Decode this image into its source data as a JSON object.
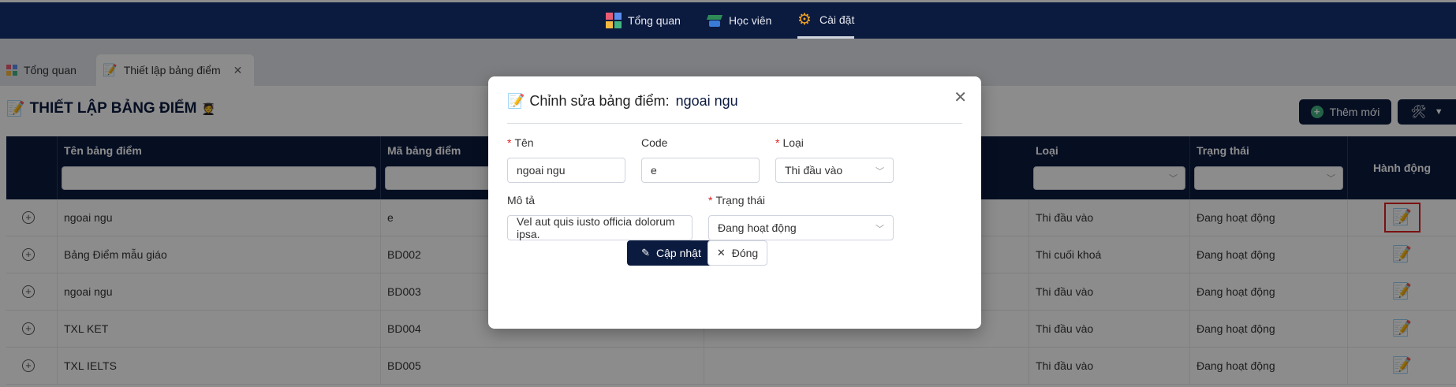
{
  "topnav": {
    "items": [
      {
        "label": "Tổng quan",
        "icon": "dashboard-icon"
      },
      {
        "label": "Học viên",
        "icon": "student-icon"
      },
      {
        "label": "Cài đặt",
        "icon": "gear-icon",
        "active": true
      }
    ]
  },
  "tabs": [
    {
      "label": "Tổng quan",
      "icon": "dashboard-icon"
    },
    {
      "label": "Thiết lập bảng điểm",
      "icon": "memo-icon",
      "active": true
    }
  ],
  "page": {
    "title": "THIẾT LẬP BẢNG ĐIỂM",
    "add_button": "Thêm mới"
  },
  "table": {
    "columns": {
      "name": "Tên bảng điểm",
      "code": "Mã bảng điểm",
      "type": "Loại",
      "status": "Trạng thái",
      "actions": "Hành động"
    },
    "rows": [
      {
        "name": "ngoai ngu",
        "code": "e",
        "type": "Thi đầu vào",
        "status": "Đang hoạt động"
      },
      {
        "name": "Bảng Điểm mẫu giáo",
        "code": "BD002",
        "type": "Thi cuối khoá",
        "status": "Đang hoạt động"
      },
      {
        "name": "ngoai ngu",
        "code": "BD003",
        "type": "Thi đầu vào",
        "status": "Đang hoạt động"
      },
      {
        "name": "TXL KET",
        "code": "BD004",
        "type": "Thi đầu vào",
        "status": "Đang hoạt động"
      },
      {
        "name": "TXL IELTS",
        "code": "BD005",
        "type": "Thi đầu vào",
        "status": "Đang hoạt động"
      }
    ]
  },
  "modal": {
    "title_prefix": "Chỉnh sửa bảng điểm:",
    "title_name": "ngoai ngu",
    "fields": {
      "name_label": "Tên",
      "name_value": "ngoai ngu",
      "code_label": "Code",
      "code_value": "e",
      "type_label": "Loại",
      "type_value": "Thi đầu vào",
      "desc_label": "Mô tả",
      "desc_value": "Vel aut quis iusto officia dolorum ipsa.",
      "status_label": "Trạng thái",
      "status_value": "Đang hoạt động"
    },
    "update_button": "Cập nhật",
    "close_button": "Đóng"
  },
  "colors": {
    "navy": "#0b1a3f",
    "required": "#e02020",
    "highlight": "#e02020"
  }
}
